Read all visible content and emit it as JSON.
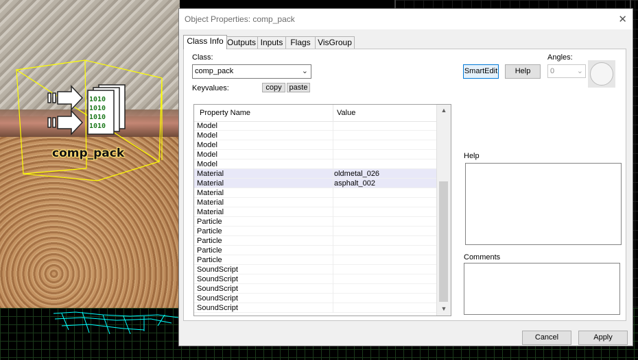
{
  "viewport": {
    "entity_label": "comp_pack",
    "icon_glyph": "1010"
  },
  "dialog": {
    "title": "Object Properties: comp_pack",
    "close_glyph": "✕",
    "tabs": [
      "Class Info",
      "Outputs",
      "Inputs",
      "Flags",
      "VisGroup"
    ],
    "active_tab": "Class Info",
    "class_label": "Class:",
    "class_value": "comp_pack",
    "keyvalues_label": "Keyvalues:",
    "copy_label": "copy",
    "paste_label": "paste",
    "smartedit_label": "SmartEdit",
    "help_button_label": "Help",
    "angles_label": "Angles:",
    "angles_value": "0",
    "grid": {
      "col_property": "Property Name",
      "col_value": "Value",
      "rows": [
        {
          "name": "Model",
          "value": ""
        },
        {
          "name": "Model",
          "value": ""
        },
        {
          "name": "Model",
          "value": ""
        },
        {
          "name": "Model",
          "value": ""
        },
        {
          "name": "Model",
          "value": ""
        },
        {
          "name": "Material",
          "value": "oldmetal_026"
        },
        {
          "name": "Material",
          "value": "asphalt_002"
        },
        {
          "name": "Material",
          "value": ""
        },
        {
          "name": "Material",
          "value": ""
        },
        {
          "name": "Material",
          "value": ""
        },
        {
          "name": "Particle",
          "value": ""
        },
        {
          "name": "Particle",
          "value": ""
        },
        {
          "name": "Particle",
          "value": ""
        },
        {
          "name": "Particle",
          "value": ""
        },
        {
          "name": "Particle",
          "value": ""
        },
        {
          "name": "SoundScript",
          "value": ""
        },
        {
          "name": "SoundScript",
          "value": ""
        },
        {
          "name": "SoundScript",
          "value": ""
        },
        {
          "name": "SoundScript",
          "value": ""
        },
        {
          "name": "SoundScript",
          "value": ""
        }
      ]
    },
    "help_box_label": "Help",
    "comments_label": "Comments",
    "cancel_label": "Cancel",
    "apply_label": "Apply"
  },
  "colors": {
    "bbox": "#ffff00",
    "mesh": "#00ffff",
    "focus": "#0078d7"
  }
}
